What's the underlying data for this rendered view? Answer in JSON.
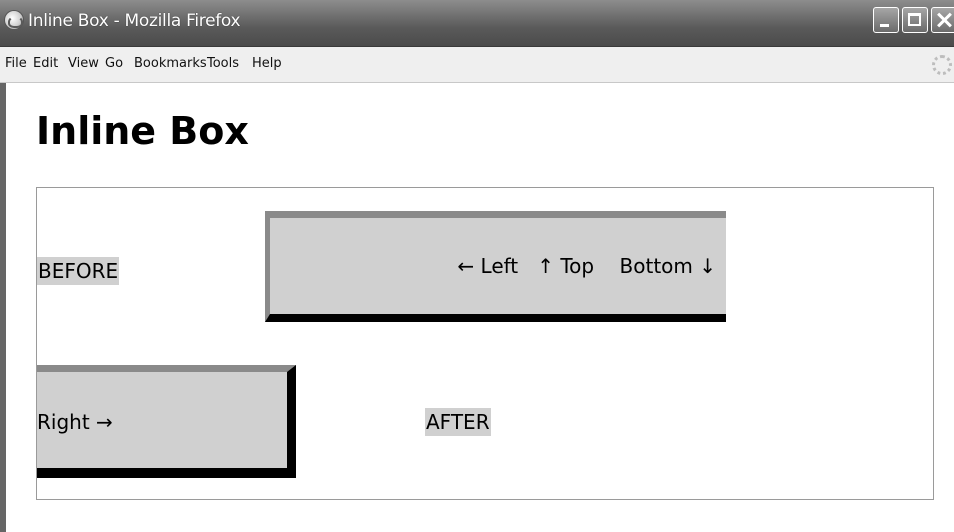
{
  "window": {
    "title": "Inline Box - Mozilla Firefox"
  },
  "menubar": {
    "items": [
      "File",
      "Edit",
      "View",
      "Go",
      "Bookmarks",
      "Tools",
      "Help"
    ]
  },
  "page": {
    "heading": "Inline Box",
    "before_label": "BEFORE",
    "after_label": "AFTER",
    "top_box_text": "← Left   ↑ Top    Bottom ↓",
    "bottom_box_text": "Right →"
  },
  "colors": {
    "label_background": "#d0d0d0",
    "border_light": "#8a8a8a",
    "border_dark": "#000000"
  }
}
